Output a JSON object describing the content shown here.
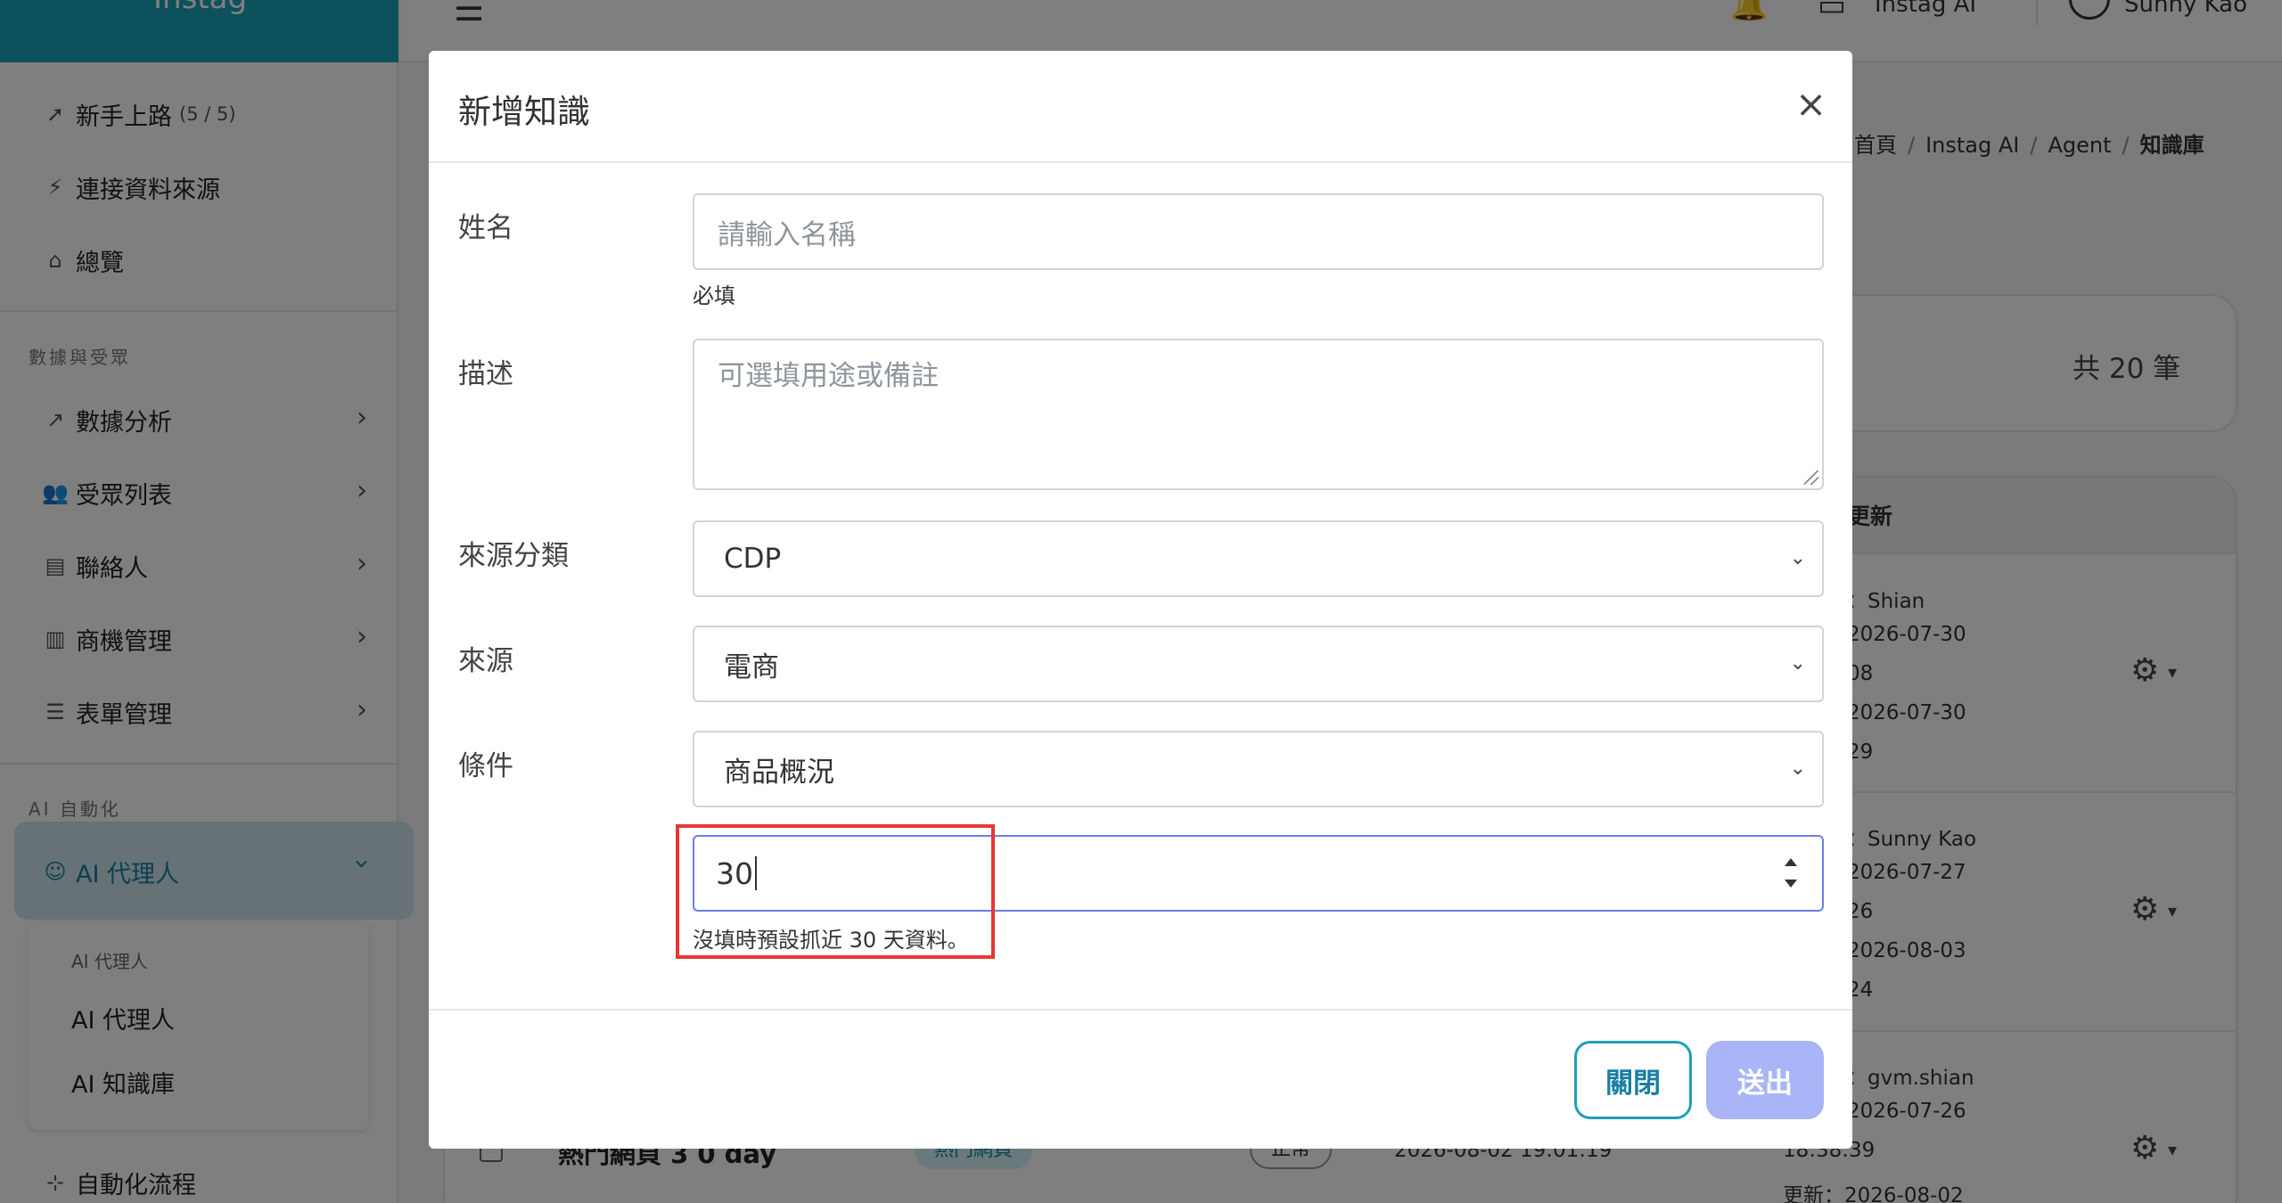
{
  "brand": {
    "name": "Instag"
  },
  "sidebar": {
    "getting_started": {
      "label": "新手上路",
      "badge": "(5 / 5)"
    },
    "connect_source": "連接資料來源",
    "overview": "總覽",
    "section_data": "數據與受眾",
    "items": [
      {
        "label": "數據分析"
      },
      {
        "label": "受眾列表"
      },
      {
        "label": "聯絡人"
      },
      {
        "label": "商機管理"
      },
      {
        "label": "表單管理"
      }
    ],
    "section_ai": "AI 自動化",
    "ai_agent": "AI 代理人",
    "submenu": {
      "title": "AI 代理人",
      "items": [
        "AI 代理人",
        "AI 知識庫"
      ]
    },
    "automation": "自動化流程"
  },
  "topbar": {
    "app": "Instag AI",
    "user": "Sunny Kao"
  },
  "breadcrumb": {
    "home": "首頁",
    "app": "Instag AI",
    "agent": "Agent",
    "current": "知識庫"
  },
  "summary": {
    "count": "共 20 筆"
  },
  "table": {
    "header_update": "更新",
    "rows": [
      {
        "creator": "：Shian",
        "created_date": "2026-07-30",
        "created_time": "08",
        "updated_date": "2026-07-30",
        "updated_time": "29"
      },
      {
        "creator": "：Sunny Kao",
        "created_date": "2026-07-27",
        "created_time": "26",
        "updated_date": "2026-08-03",
        "updated_time": "24"
      },
      {
        "creator": "：gvm.shian",
        "created_date": "2026-07-26",
        "created_time": "18:38:39",
        "updated_date": "更新：2026-08-02"
      }
    ],
    "bottom_row": {
      "name": "熱門網頁 3 0 day",
      "tag": "熱門網頁",
      "status": "正常",
      "time": "2026-08-02 19:01:19"
    }
  },
  "modal": {
    "title": "新增知識",
    "close_icon": "×",
    "fields": {
      "name": {
        "label": "姓名",
        "placeholder": "請輸入名稱",
        "help": "必填"
      },
      "description": {
        "label": "描述",
        "placeholder": "可選填用途或備註"
      },
      "source_category": {
        "label": "來源分類",
        "value": "CDP"
      },
      "source": {
        "label": "來源",
        "value": "電商"
      },
      "condition": {
        "label": "條件",
        "value": "商品概況"
      },
      "days": {
        "value": "30",
        "help": "沒填時預設抓近 30 天資料。"
      }
    },
    "buttons": {
      "close": "關閉",
      "submit": "送出"
    }
  },
  "colors": {
    "brand": "#1aa2b8",
    "highlight": "#e53935",
    "submit_disabled": "#a9b5f7",
    "focus_border": "#6b7de8"
  }
}
